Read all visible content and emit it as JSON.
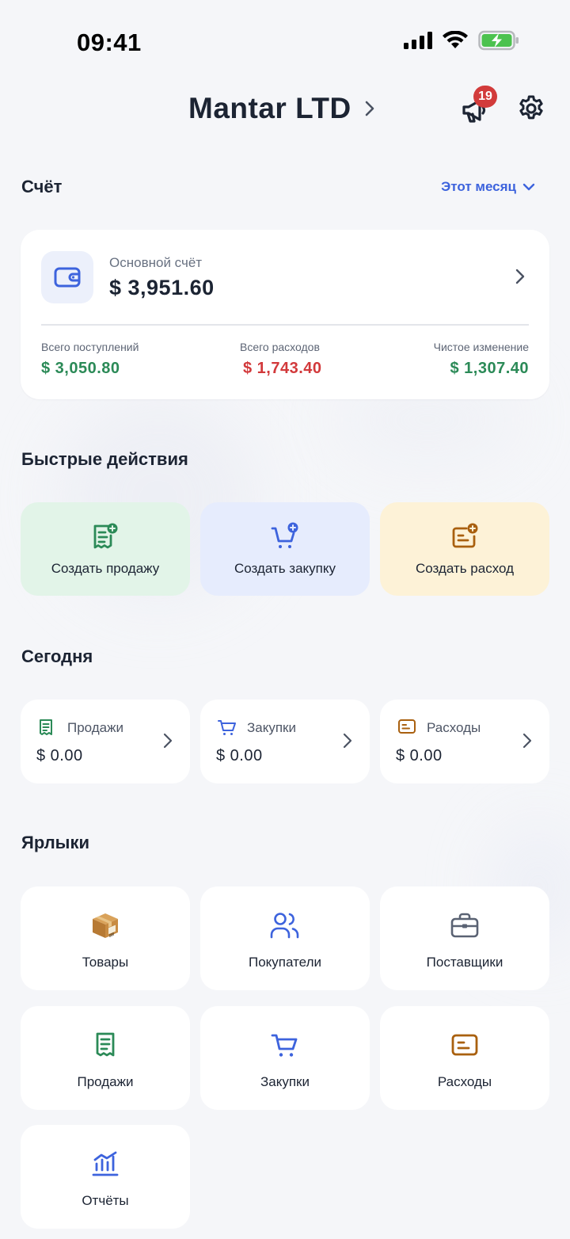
{
  "status_bar": {
    "time": "09:41"
  },
  "header": {
    "company_name": "Mantar LTD",
    "notifications_count": "19"
  },
  "account_section": {
    "title": "Счёт",
    "period_label": "Этот месяц",
    "account_name": "Основной счёт",
    "balance": "$ 3,951.60",
    "stats": [
      {
        "label": "Всего поступлений",
        "value": "$ 3,050.80"
      },
      {
        "label": "Всего расходов",
        "value": "$ 1,743.40"
      },
      {
        "label": "Чистое изменение",
        "value": "$ 1,307.40"
      }
    ]
  },
  "quick_actions": {
    "title": "Быстрые действия",
    "items": [
      {
        "label": "Создать продажу",
        "icon": "receipt-plus-icon"
      },
      {
        "label": "Создать закупку",
        "icon": "cart-plus-icon"
      },
      {
        "label": "Создать расход",
        "icon": "expense-plus-icon"
      }
    ]
  },
  "today": {
    "title": "Сегодня",
    "items": [
      {
        "label": "Продажи",
        "value": "$ 0.00",
        "icon": "receipt-icon"
      },
      {
        "label": "Закупки",
        "value": "$ 0.00",
        "icon": "cart-icon"
      },
      {
        "label": "Расходы",
        "value": "$ 0.00",
        "icon": "expense-icon"
      }
    ]
  },
  "shortcuts": {
    "title": "Ярлыки",
    "items": [
      {
        "label": "Товары",
        "icon": "package-icon"
      },
      {
        "label": "Покупатели",
        "icon": "users-icon"
      },
      {
        "label": "Поставщики",
        "icon": "briefcase-icon"
      },
      {
        "label": "Продажи",
        "icon": "receipt-icon"
      },
      {
        "label": "Закупки",
        "icon": "cart-icon"
      },
      {
        "label": "Расходы",
        "icon": "expense-icon"
      },
      {
        "label": "Отчёты",
        "icon": "chart-icon"
      }
    ]
  },
  "colors": {
    "accent": "#3d63dd",
    "positive": "#2b8a57",
    "negative": "#d2393b",
    "sale": "#2b8a57",
    "purchase": "#3d63dd",
    "expense": "#a9600f"
  }
}
